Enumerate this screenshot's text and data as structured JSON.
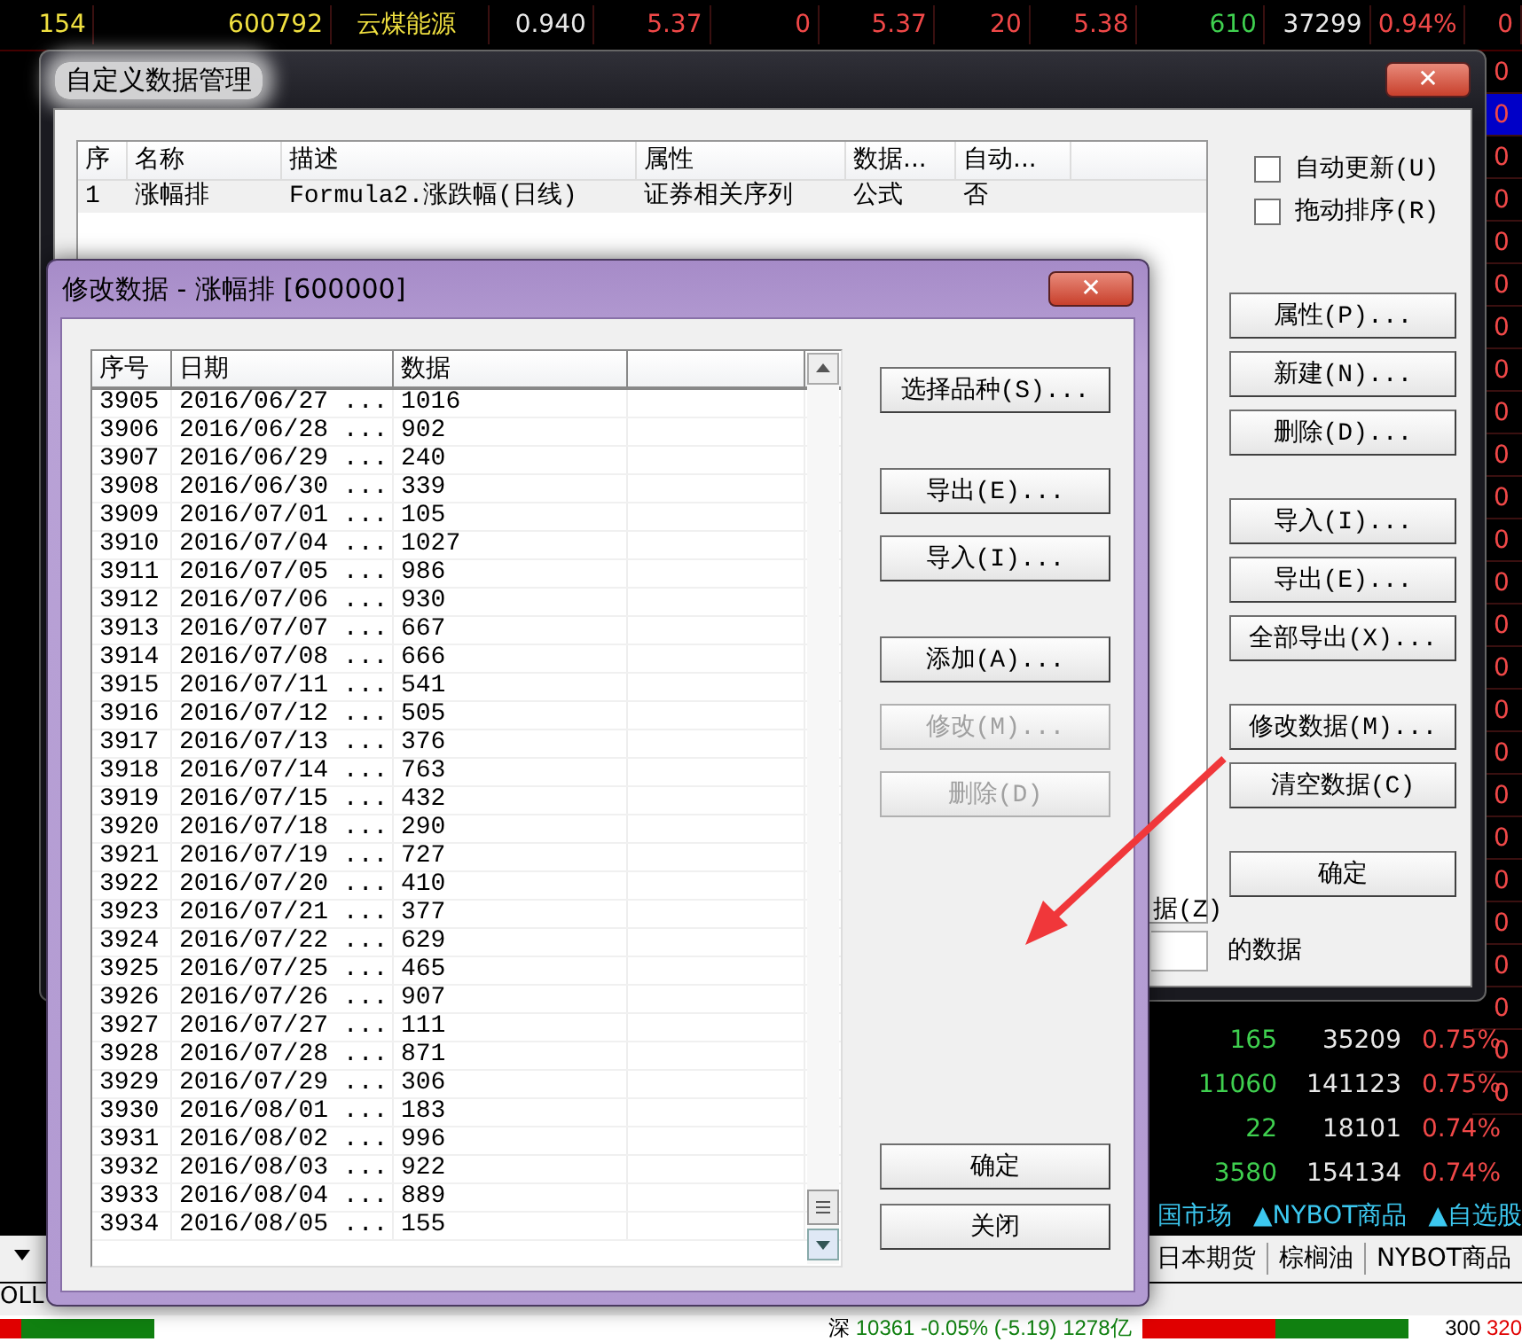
{
  "quote_table": {
    "top_row": [
      {
        "text": "154",
        "color": "#f0e040"
      },
      {
        "text": "600792",
        "color": "#f0e040"
      },
      {
        "text": "云煤能源",
        "color": "#f0e040"
      },
      {
        "text": "0.940",
        "color": "#e8e8e8"
      },
      {
        "text": "5.37",
        "color": "#f04848"
      },
      {
        "text": "0",
        "color": "#f04848"
      },
      {
        "text": "5.37",
        "color": "#f04848"
      },
      {
        "text": "20",
        "color": "#f04848"
      },
      {
        "text": "5.38",
        "color": "#f04848"
      },
      {
        "text": "610",
        "color": "#3fd04f"
      },
      {
        "text": "37299",
        "color": "#e8e8e8"
      },
      {
        "text": "0.94%",
        "color": "#f04848"
      },
      {
        "text": "0",
        "color": "#f04848"
      }
    ],
    "edge_column": [
      {
        "text": "0",
        "selected": false
      },
      {
        "text": "0",
        "selected": true
      },
      {
        "text": "0",
        "selected": false
      },
      {
        "text": "0",
        "selected": false
      },
      {
        "text": "0",
        "selected": false
      },
      {
        "text": "0",
        "selected": false
      },
      {
        "text": "0",
        "selected": false
      },
      {
        "text": "0",
        "selected": false
      },
      {
        "text": "0",
        "selected": false
      },
      {
        "text": "0",
        "selected": false
      },
      {
        "text": "0",
        "selected": false
      },
      {
        "text": "0",
        "selected": false
      },
      {
        "text": "0",
        "selected": false
      },
      {
        "text": "0",
        "selected": false
      },
      {
        "text": "0",
        "selected": false
      },
      {
        "text": "0",
        "selected": false
      },
      {
        "text": "0",
        "selected": false
      },
      {
        "text": "0",
        "selected": false
      },
      {
        "text": "0",
        "selected": false
      },
      {
        "text": "0",
        "selected": false
      },
      {
        "text": "0",
        "selected": false
      },
      {
        "text": "0",
        "selected": false
      },
      {
        "text": "0",
        "selected": false
      },
      {
        "text": "0",
        "selected": false
      },
      {
        "text": "0",
        "selected": false
      }
    ],
    "lower_rows": [
      {
        "change": "165",
        "volume": "35209",
        "percent": "0.75%"
      },
      {
        "change": "11060",
        "volume": "141123",
        "percent": "0.75%"
      },
      {
        "change": "22",
        "volume": "18101",
        "percent": "0.74%"
      },
      {
        "change": "3580",
        "volume": "154134",
        "percent": "0.74%"
      }
    ]
  },
  "market_tabs": [
    "国市场",
    "▲NYBOT商品",
    "▲自选股"
  ],
  "category_tabs": [
    "日本期货",
    "棕榈油",
    "NYBOT商品"
  ],
  "status_bar": {
    "left_label": "OLL",
    "index_name": "深",
    "index_value": "10361 -0.05% (-5.19) 1278亿",
    "right_label": "300",
    "right_value": "320"
  },
  "main_dialog": {
    "title": "自定义数据管理",
    "close": "✕",
    "columns": [
      "序",
      "名称",
      "描述",
      "属性",
      "数据...",
      "自动..."
    ],
    "rows": [
      [
        "1",
        "涨幅排",
        "Formula2.涨跌幅(日线)",
        "证券相关序列",
        "公式",
        "否"
      ]
    ],
    "checkboxes": [
      {
        "label": "自动更新(U)",
        "checked": false
      },
      {
        "label": "拖动排序(R)",
        "checked": false
      }
    ],
    "button_groups": [
      [
        {
          "label": "属性(P)...",
          "disabled": false
        },
        {
          "label": "新建(N)...",
          "disabled": false
        },
        {
          "label": "删除(D)...",
          "disabled": false
        }
      ],
      [
        {
          "label": "导入(I)...",
          "disabled": false
        },
        {
          "label": "导出(E)...",
          "disabled": false
        },
        {
          "label": "全部导出(X)...",
          "disabled": false
        }
      ],
      [
        {
          "label": "修改数据(M)...",
          "disabled": false
        },
        {
          "label": "清空数据(C)",
          "disabled": false
        }
      ],
      [
        {
          "label": "确定",
          "disabled": false
        }
      ]
    ],
    "partial_label": "据(Z)",
    "suffix_label": "的数据"
  },
  "edit_dialog": {
    "title": "修改数据 - 涨幅排 [600000]",
    "close": "✕",
    "columns": [
      "序号",
      "日期",
      "数据"
    ],
    "rows": [
      [
        "3905",
        "2016/06/27 ...",
        "1016"
      ],
      [
        "3906",
        "2016/06/28 ...",
        "902"
      ],
      [
        "3907",
        "2016/06/29 ...",
        "240"
      ],
      [
        "3908",
        "2016/06/30 ...",
        "339"
      ],
      [
        "3909",
        "2016/07/01 ...",
        "105"
      ],
      [
        "3910",
        "2016/07/04 ...",
        "1027"
      ],
      [
        "3911",
        "2016/07/05 ...",
        "986"
      ],
      [
        "3912",
        "2016/07/06 ...",
        "930"
      ],
      [
        "3913",
        "2016/07/07 ...",
        "667"
      ],
      [
        "3914",
        "2016/07/08 ...",
        "666"
      ],
      [
        "3915",
        "2016/07/11 ...",
        "541"
      ],
      [
        "3916",
        "2016/07/12 ...",
        "505"
      ],
      [
        "3917",
        "2016/07/13 ...",
        "376"
      ],
      [
        "3918",
        "2016/07/14 ...",
        "763"
      ],
      [
        "3919",
        "2016/07/15 ...",
        "432"
      ],
      [
        "3920",
        "2016/07/18 ...",
        "290"
      ],
      [
        "3921",
        "2016/07/19 ...",
        "727"
      ],
      [
        "3922",
        "2016/07/20 ...",
        "410"
      ],
      [
        "3923",
        "2016/07/21 ...",
        "377"
      ],
      [
        "3924",
        "2016/07/22 ...",
        "629"
      ],
      [
        "3925",
        "2016/07/25 ...",
        "465"
      ],
      [
        "3926",
        "2016/07/26 ...",
        "907"
      ],
      [
        "3927",
        "2016/07/27 ...",
        "111"
      ],
      [
        "3928",
        "2016/07/28 ...",
        "871"
      ],
      [
        "3929",
        "2016/07/29 ...",
        "306"
      ],
      [
        "3930",
        "2016/08/01 ...",
        "183"
      ],
      [
        "3931",
        "2016/08/02 ...",
        "996"
      ],
      [
        "3932",
        "2016/08/03 ...",
        "922"
      ],
      [
        "3933",
        "2016/08/04 ...",
        "889"
      ],
      [
        "3934",
        "2016/08/05 ...",
        "155"
      ]
    ],
    "button_groups": [
      [
        {
          "label": "选择品种(S)...",
          "disabled": false
        }
      ],
      [
        {
          "label": "导出(E)...",
          "disabled": false
        },
        {
          "label": "导入(I)...",
          "disabled": false
        }
      ],
      [
        {
          "label": "添加(A)...",
          "disabled": false
        },
        {
          "label": "修改(M)...",
          "disabled": true
        },
        {
          "label": "删除(D)",
          "disabled": true
        }
      ],
      [
        {
          "label": "确定",
          "disabled": false
        },
        {
          "label": "关闭",
          "disabled": false
        }
      ]
    ]
  }
}
